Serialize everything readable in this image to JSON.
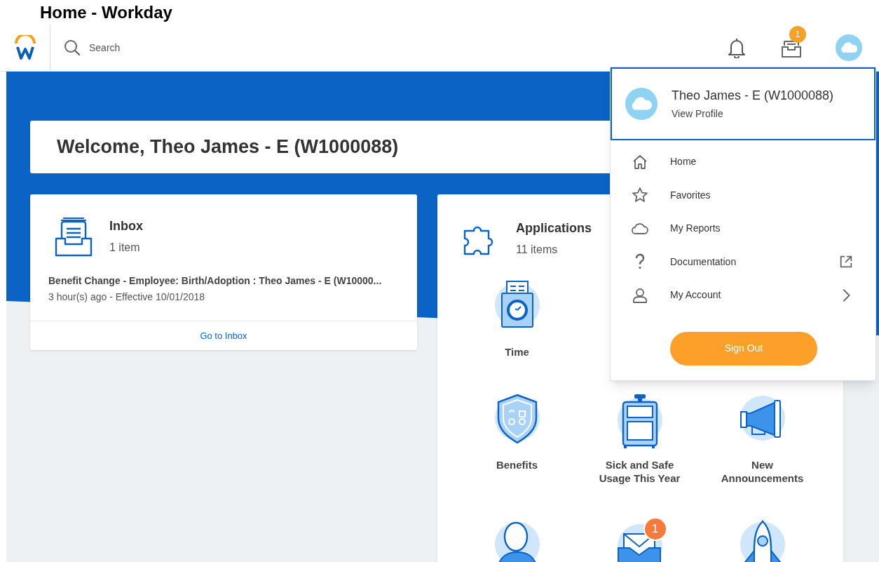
{
  "page_title": "Home - Workday",
  "header": {
    "search_placeholder": "Search",
    "inbox_badge": "1"
  },
  "welcome": "Welcome, Theo James - E (W1000088)",
  "inbox_card": {
    "title": "Inbox",
    "count": "1 item",
    "task_title": "Benefit Change - Employee: Birth/Adoption : Theo James - E (W10000...",
    "task_meta": "3 hour(s) ago - Effective 10/01/2018",
    "link": "Go to Inbox"
  },
  "applications": {
    "title": "Applications",
    "count": "11 items",
    "rows": [
      [
        {
          "kind": "time",
          "label": "Time"
        }
      ],
      [
        {
          "kind": "benefits",
          "label": "Benefits"
        },
        {
          "kind": "sick",
          "label": "Sick and Safe Usage This Year"
        },
        {
          "kind": "announcements",
          "label": "New Announcements"
        }
      ],
      [
        {
          "kind": "person"
        },
        {
          "kind": "mail",
          "badge": "1"
        },
        {
          "kind": "rocket"
        }
      ]
    ]
  },
  "profile_menu": {
    "name": "Theo James - E (W1000088)",
    "link": "View Profile",
    "items": [
      {
        "kind": "home",
        "label": "Home"
      },
      {
        "kind": "favorites",
        "label": "Favorites"
      },
      {
        "kind": "reports",
        "label": "My Reports"
      },
      {
        "kind": "documentation",
        "label": "Documentation"
      },
      {
        "kind": "account",
        "label": "My Account"
      }
    ],
    "sign_out": "Sign Out"
  }
}
